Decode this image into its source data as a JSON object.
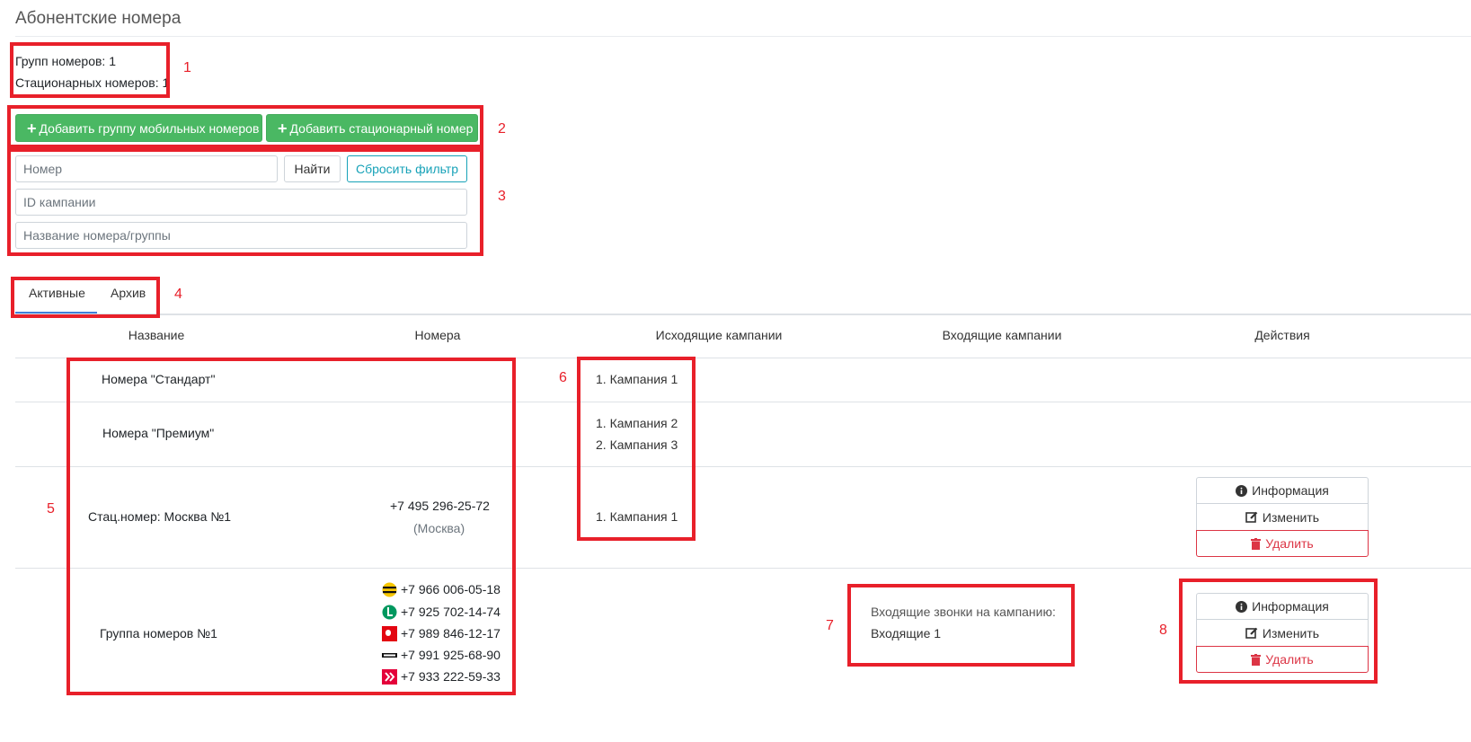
{
  "page": {
    "title": "Абонентские номера"
  },
  "stats": {
    "groups": "Групп номеров: 1",
    "stationary": "Стационарных номеров: 1"
  },
  "actions": {
    "add_mobile_group": "Добавить группу мобильных номеров",
    "add_stationary": "Добавить стационарный номер"
  },
  "filters": {
    "number_placeholder": "Номер",
    "find_label": "Найти",
    "reset_label": "Сбросить фильтр",
    "campaign_id_placeholder": "ID кампании",
    "name_placeholder": "Название номера/группы"
  },
  "tabs": [
    {
      "label": "Активные",
      "active": true
    },
    {
      "label": "Архив",
      "active": false
    }
  ],
  "table": {
    "columns": [
      "Название",
      "Номера",
      "Исходящие кампании",
      "Входящие кампании",
      "Действия"
    ],
    "rows": [
      {
        "name": "Номера \"Стандарт\"",
        "outgoing": [
          "1. Кампания 1"
        ]
      },
      {
        "name": "Номера \"Премиум\"",
        "outgoing": [
          "1. Кампания 2",
          "2. Кампания 3"
        ]
      },
      {
        "name": "Стац.номер: Москва №1",
        "number": "+7 495 296-25-72",
        "region": "(Москва)",
        "outgoing": [
          "1. Кампания 1"
        ],
        "actions": {
          "info": "Информация",
          "edit": "Изменить",
          "delete": "Удалить"
        }
      },
      {
        "name": "Группа номеров №1",
        "numbers": [
          {
            "operator_icon": "beeline-icon",
            "number": "+7 966 006-05-18"
          },
          {
            "operator_icon": "megafon-icon",
            "number": "+7 925 702-14-74"
          },
          {
            "operator_icon": "mts-icon",
            "number": "+7 989 846-12-17"
          },
          {
            "operator_icon": "tele2-icon",
            "number": "+7 991 925-68-90"
          },
          {
            "operator_icon": "yota-icon",
            "number": "+7 933 222-59-33"
          }
        ],
        "incoming_label": "Входящие звонки на кампанию:",
        "incoming_value": "Входящие 1",
        "actions": {
          "info": "Информация",
          "edit": "Изменить",
          "delete": "Удалить"
        }
      }
    ]
  },
  "annotations": [
    "1",
    "2",
    "3",
    "4",
    "5",
    "6",
    "7",
    "8"
  ],
  "colors": {
    "annotation": "#e8202a",
    "primary_button": "#4ab863",
    "outline_info": "#17a2b8",
    "danger": "#dc3545",
    "tab_active": "#3f7fd9"
  }
}
